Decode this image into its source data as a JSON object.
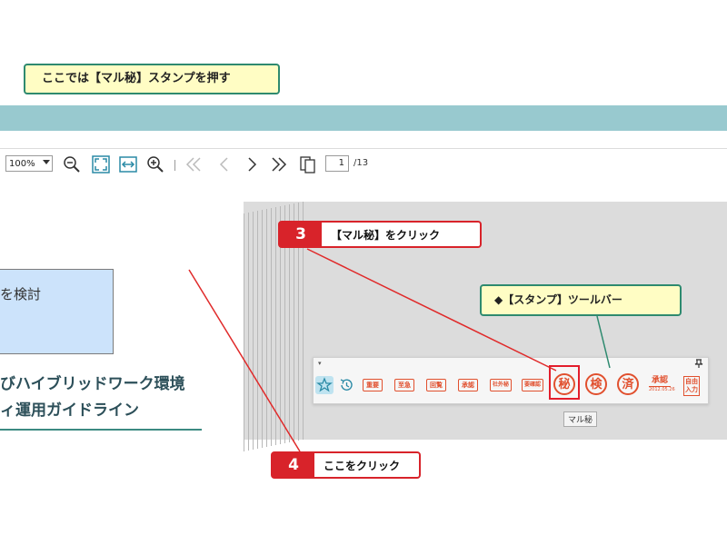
{
  "instruction": "ここでは【マル秘】スタンプを押す",
  "toolbar": {
    "zoom_value": "100%",
    "page_current": "1",
    "page_total": "/13"
  },
  "document": {
    "box_text": "を検討",
    "title_line1": "びハイブリッドワーク環境",
    "title_line2": "ィ運用ガイドライン"
  },
  "stamp_toolbar": {
    "dropdown_glyph": "▾",
    "pin_glyph": "📌",
    "stamps": {
      "juyo": "重要",
      "shikyu": "至急",
      "kairan": "回覧",
      "shonin": "承認",
      "shagaihi": "社外秘",
      "kessai": "要確認",
      "maruhi": "秘",
      "ken": "検",
      "sumi": "済",
      "approve_big": "承認",
      "approve_small": "2012.05.26",
      "free_input": "自由入力"
    },
    "tooltip": "マル秘"
  },
  "steps": {
    "step3": {
      "num": "3",
      "label": "【マル秘】をクリック"
    },
    "step4": {
      "num": "4",
      "label": "ここをクリック"
    }
  },
  "stamp_callout": "◆【スタンプ】ツールバー",
  "colors": {
    "accent_red": "#d8232a",
    "stamp_red": "#e1502e",
    "teal": "#2e8a6f",
    "titlebar": "#98c9cf",
    "callout_bg": "#fffdc4"
  }
}
